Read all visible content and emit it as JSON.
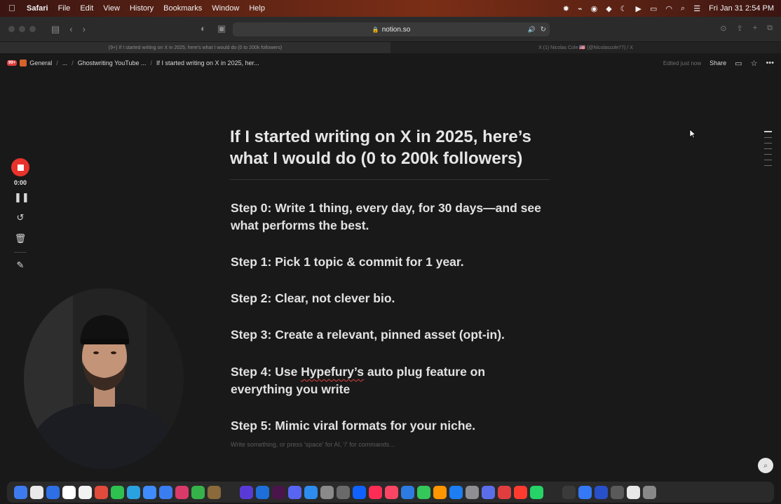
{
  "menubar": {
    "app": "Safari",
    "items": [
      "File",
      "Edit",
      "View",
      "History",
      "Bookmarks",
      "Window",
      "Help"
    ],
    "datetime": "Fri Jan 31  2:54 PM"
  },
  "toolbar": {
    "url": "notion.so"
  },
  "tabs": [
    {
      "label": "(9+) If I started writing on X in 2025, here's what I would do (0 to 200k followers)"
    },
    {
      "label": "X   (1) Nicolas Cole 🇺🇸 (@Nicolascole77) / X"
    }
  ],
  "notion": {
    "badge": "99+",
    "breadcrumb": [
      "General",
      "...",
      "Ghostwriting YouTube ...",
      "If I started writing on X in 2025, her..."
    ],
    "edited": "Edited just now",
    "share": "Share"
  },
  "page": {
    "title": "If I started writing on X in 2025, here’s what I would do (0 to 200k followers)",
    "steps": [
      {
        "text": "Step 0: Write 1 thing, every day, for 30 days—and see what performs the best."
      },
      {
        "text": "Step 1: Pick 1 topic & commit for 1 year."
      },
      {
        "text": "Step 2: Clear, not clever bio."
      },
      {
        "text": "Step 3: Create a relevant, pinned asset (opt-in)."
      },
      {
        "prefix": "Step 4: Use ",
        "highlight": "Hypefury’s",
        "suffix": " auto plug feature on everything you write"
      },
      {
        "text": "Step 5: Mimic viral formats for your niche."
      }
    ],
    "placeholder": "Write something, or press 'space' for AI, '/' for commands…"
  },
  "recorder": {
    "time": "0:00"
  },
  "colors": {
    "background": "#191919",
    "accent_red": "#e8322c",
    "text": "#e6e6e6"
  }
}
